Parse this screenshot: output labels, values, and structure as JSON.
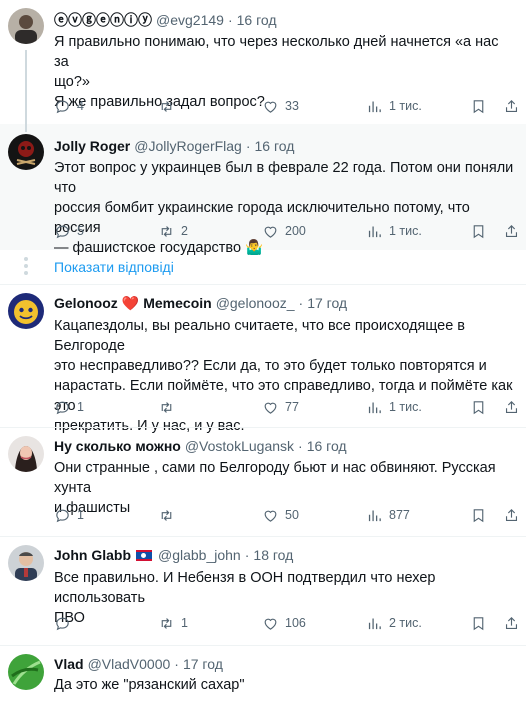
{
  "show_replies_label": "Показати відповіді",
  "tweets": [
    {
      "name": "ⓔⓥⓖⓔⓝⓘⓨ",
      "handle": "@evg2149",
      "time": "16 год",
      "text": [
        "Я правильно понимаю, что через несколько дней начнется «а нас за",
        "що?»",
        "Я же правильно задал вопрос?"
      ],
      "replies": "4",
      "reposts": "",
      "likes": "33",
      "views": "1 тис."
    },
    {
      "name": "Jolly Roger",
      "handle": "@JollyRogerFlag",
      "time": "16 год",
      "text": [
        "Этот вопрос у украинцев был в феврале 22 года. Потом они поняли что",
        "россия бомбит украинские города исключительно потому, что россия",
        "— фашистское государство 🤷‍♂️"
      ],
      "replies": "5",
      "reposts": "2",
      "likes": "200",
      "views": "1 тис."
    },
    {
      "name": "Gelonooz",
      "badge": "❤️",
      "name_suffix": "Memecoin",
      "handle": "@gelonooz_",
      "time": "17 год",
      "text": [
        "Кацапездолы, вы реально считаете, что все происходящее в Белгороде",
        "это несправедливо?? Если да, то это будет только повторятся и",
        "нарастать. Если поймёте, что это справедливо, тогда и поймёте как это",
        "прекратить. И у нас, и у вас."
      ],
      "replies": "1",
      "reposts": "",
      "likes": "77",
      "views": "1 тис."
    },
    {
      "name": "Ну сколько можно",
      "handle": "@VostokLugansk",
      "time": "16 год",
      "text": [
        "Они странные , сами по Белгороду бьют и нас обвиняют. Русская хунта",
        "и фашисты"
      ],
      "replies": "1",
      "reposts": "",
      "likes": "50",
      "views": "877"
    },
    {
      "name": "John Glabb",
      "handle": "@glabb_john",
      "time": "18 год",
      "text": [
        "Все правильно. И Небензя в ООН подтвердил что нехер использовать",
        "ПВО"
      ],
      "replies": "",
      "reposts": "1",
      "likes": "106",
      "views": "2 тис."
    },
    {
      "name": "Vlad",
      "handle": "@VladV0000",
      "time": "17 год",
      "text": [
        "Да это же \"рязанский сахар\""
      ],
      "replies": "",
      "reposts": "",
      "likes": "",
      "views": ""
    }
  ]
}
